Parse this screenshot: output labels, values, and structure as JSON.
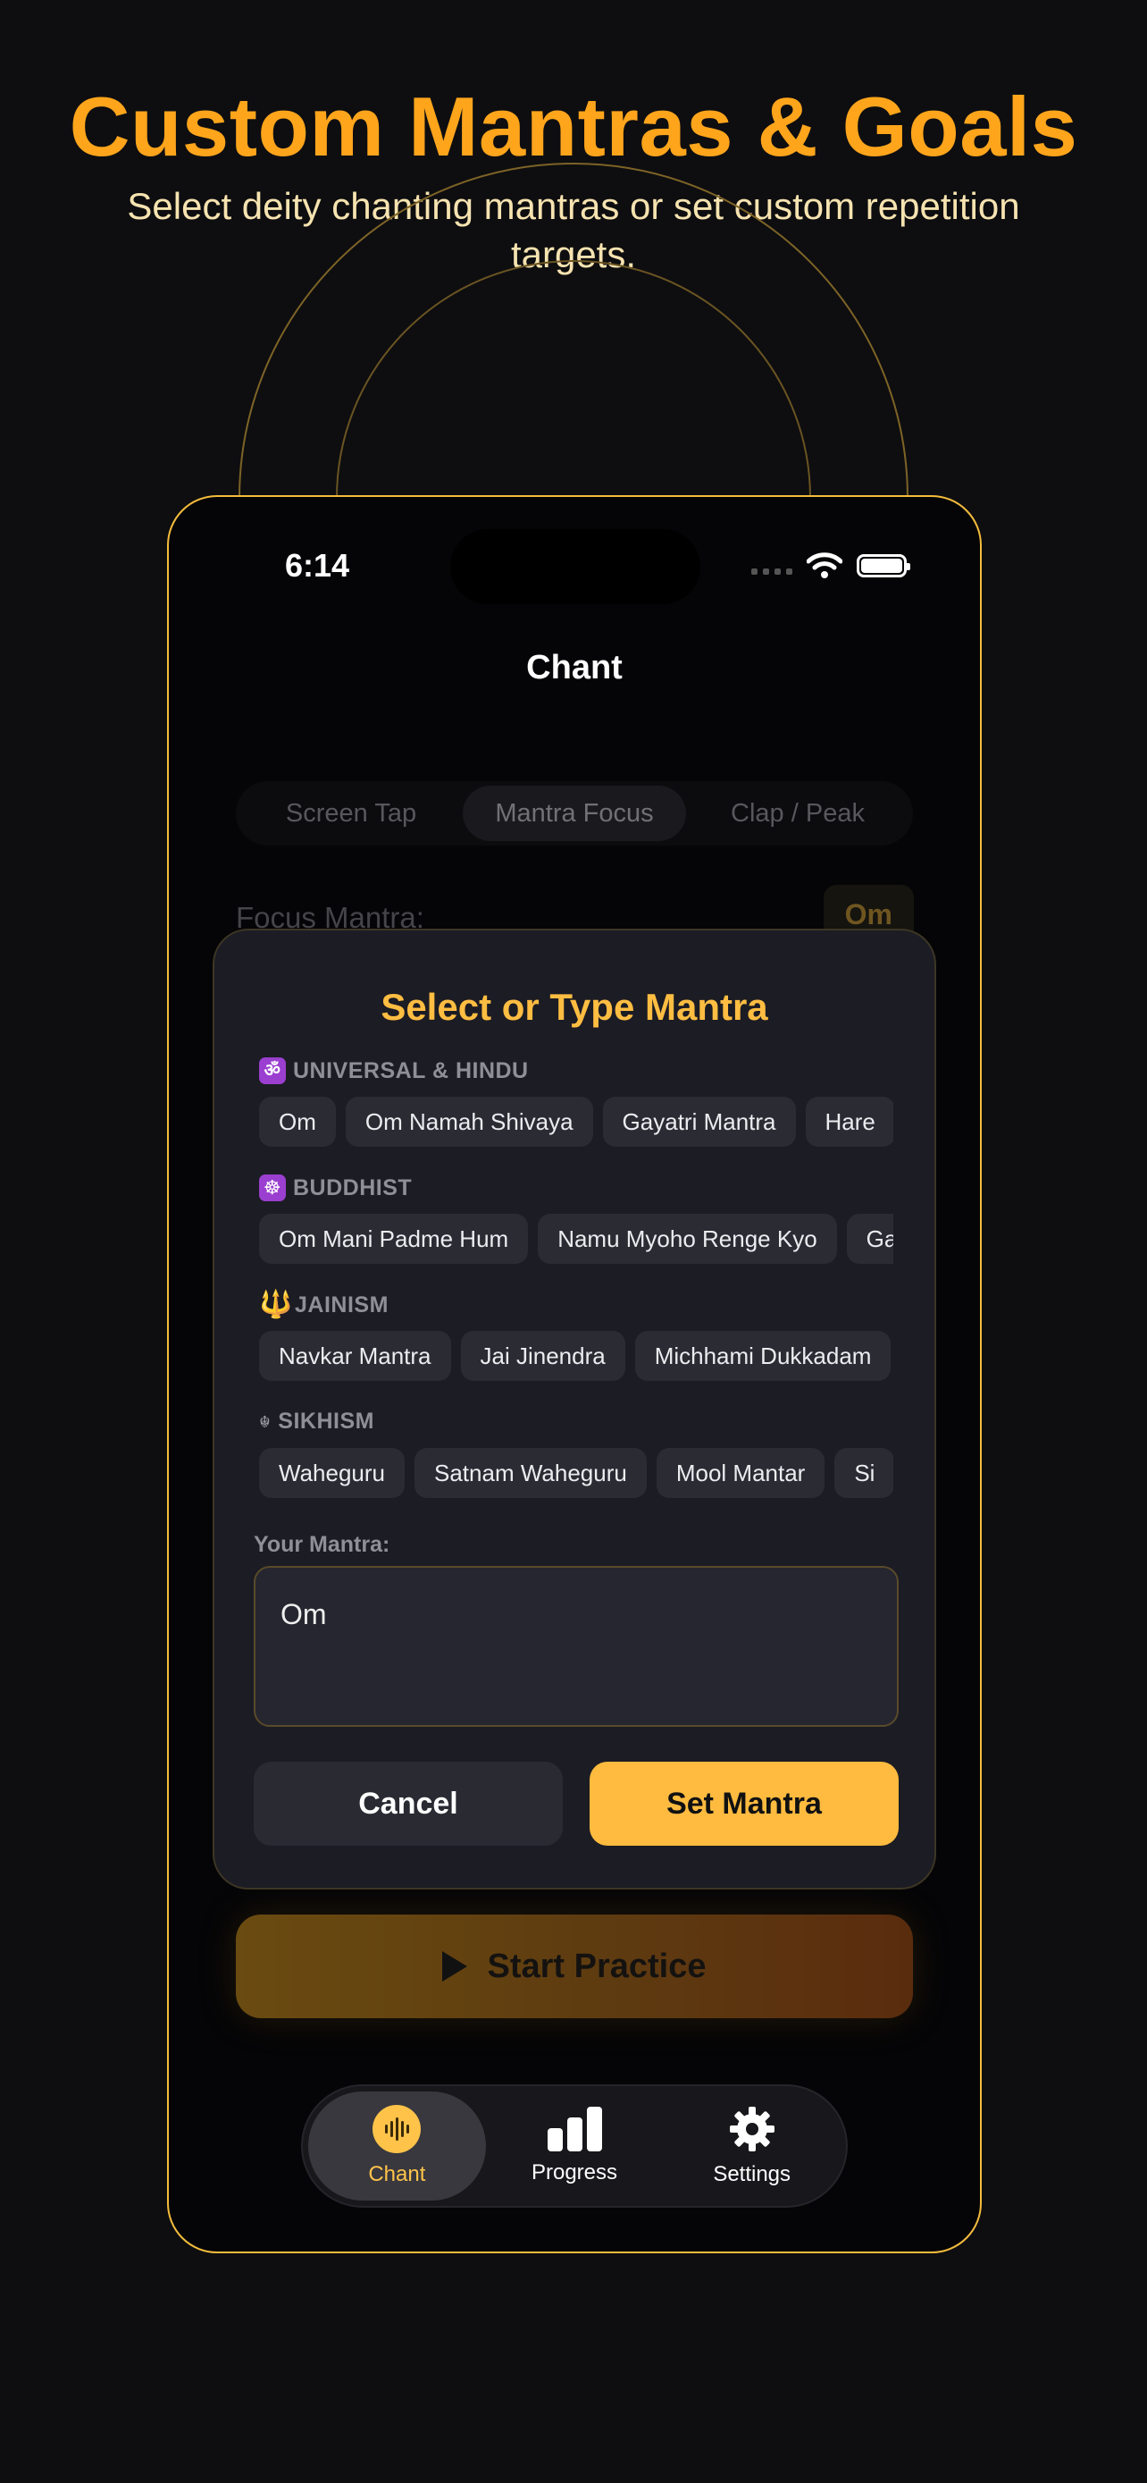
{
  "promo": {
    "headline": "Custom Mantras & Goals",
    "subline": "Select deity chanting mantras or set custom repetition targets."
  },
  "status_bar": {
    "time": "6:14"
  },
  "nav": {
    "title": "Chant"
  },
  "mode_selector": {
    "segments": [
      "Screen Tap",
      "Mantra Focus",
      "Clap / Peak"
    ],
    "selected": "Mantra Focus"
  },
  "focus": {
    "label": "Focus Mantra:",
    "value": "Om"
  },
  "modal": {
    "title": "Select or Type Mantra",
    "groups": [
      {
        "label": "UNIVERSAL & HINDU",
        "icon": "om-icon",
        "chips": [
          "Om",
          "Om Namah Shivaya",
          "Gayatri Mantra",
          "Hare"
        ]
      },
      {
        "label": "BUDDHIST",
        "icon": "dharma-wheel-icon",
        "chips": [
          "Om Mani Padme Hum",
          "Namu Myoho Renge Kyo",
          "Ga"
        ]
      },
      {
        "label": "JAINISM",
        "icon": "trident-icon",
        "chips": [
          "Navkar Mantra",
          "Jai Jinendra",
          "Michhami Dukkadam"
        ]
      },
      {
        "label": "SIKHISM",
        "icon": "khanda-icon",
        "chips": [
          "Waheguru",
          "Satnam Waheguru",
          "Mool Mantar",
          "Si"
        ]
      }
    ],
    "input_label": "Your Mantra:",
    "input_value": "Om",
    "cancel_label": "Cancel",
    "confirm_label": "Set Mantra"
  },
  "start_button": {
    "label": "Start Practice"
  },
  "tab_bar": {
    "tabs": [
      {
        "label": "Chant",
        "icon": "waveform-icon",
        "active": true
      },
      {
        "label": "Progress",
        "icon": "bar-chart-icon",
        "active": false
      },
      {
        "label": "Settings",
        "icon": "gear-icon",
        "active": false
      }
    ]
  },
  "colors": {
    "accent": "#ffbb3f",
    "headline": "#ffa51c",
    "background": "#0e0e10",
    "phone_border": "#f4bc3c"
  }
}
